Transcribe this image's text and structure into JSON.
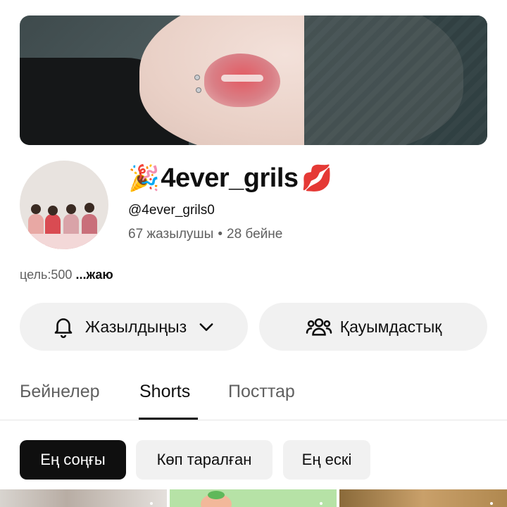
{
  "channel": {
    "name": "4ever_grils",
    "name_emoji_left": "🎉",
    "name_emoji_right": "💋",
    "handle": "@4ever_grils0",
    "subscribers": "67 жазылушы",
    "separator": "•",
    "videos": "28 бейне"
  },
  "description": {
    "text": "цель:500 ",
    "more": "...жаю"
  },
  "actions": {
    "subscribe_label": "Жазылдыңыз",
    "community_label": "Қауымдастық"
  },
  "tabs": [
    {
      "label": "Бейнелер",
      "active": false
    },
    {
      "label": "Shorts",
      "active": true
    },
    {
      "label": "Посттар",
      "active": false
    }
  ],
  "filters": [
    {
      "label": "Ең соңғы",
      "active": true
    },
    {
      "label": "Көп таралған",
      "active": false
    },
    {
      "label": "Ең ескі",
      "active": false
    }
  ],
  "icons": {
    "subscribe": "bell-icon",
    "dropdown": "chevron-down-icon",
    "community": "people-icon"
  },
  "colors": {
    "text_primary": "#0f0f0f",
    "text_secondary": "#606060",
    "chip_background": "#f1f1f1",
    "active_chip": "#0f0f0f"
  }
}
